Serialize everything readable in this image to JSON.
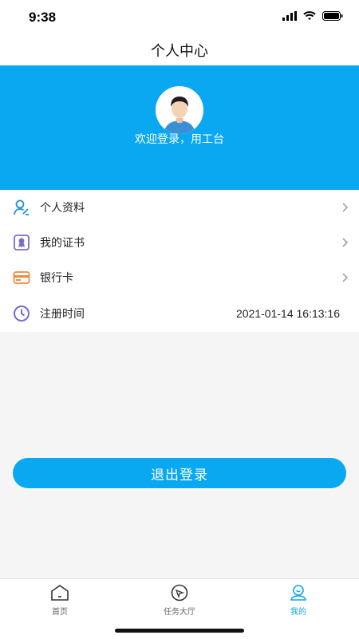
{
  "status_bar": {
    "time": "9:38"
  },
  "nav": {
    "title": "个人中心"
  },
  "profile": {
    "welcome": "欢迎登录，用工台"
  },
  "menu": {
    "items": [
      {
        "label": "个人资料",
        "icon": "profile-icon"
      },
      {
        "label": "我的证书",
        "icon": "certificate-icon"
      },
      {
        "label": "银行卡",
        "icon": "bank-card-icon"
      },
      {
        "label": "注册时间",
        "icon": "clock-icon",
        "value": "2021-01-14 16:13:16"
      }
    ]
  },
  "logout": {
    "label": "退出登录"
  },
  "tabs": [
    {
      "label": "首页",
      "icon": "home-icon"
    },
    {
      "label": "任务大厅",
      "icon": "task-hall-icon"
    },
    {
      "label": "我的",
      "icon": "user-icon",
      "active": true
    }
  ],
  "colors": {
    "accent": "#0aa8f0",
    "bank_orange": "#f08a3c",
    "clock_purple": "#6b6fd6"
  }
}
